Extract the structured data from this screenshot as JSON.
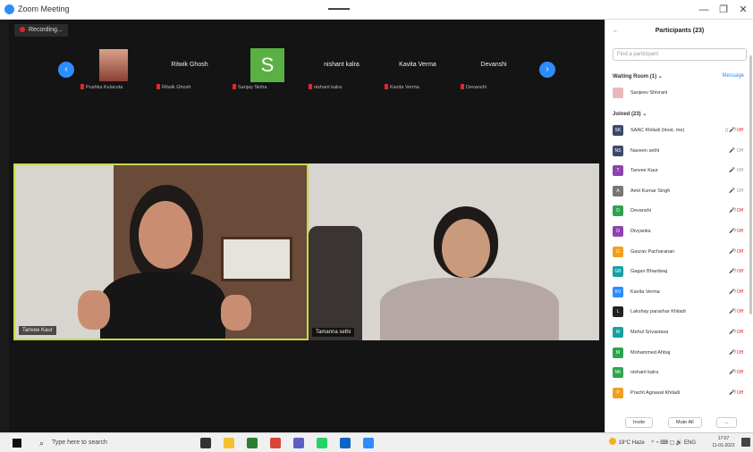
{
  "window": {
    "title": "Zoom Meeting",
    "controls": {
      "minimize": "—",
      "restore": "❐",
      "close": "✕"
    }
  },
  "meeting": {
    "recording_label": "Recording...",
    "gallery": [
      {
        "name": "",
        "label": "Pushka Kulacuta",
        "kind": "photo"
      },
      {
        "name": "Ritwik Ghosh",
        "label": "Ritwik Ghosh",
        "kind": "name"
      },
      {
        "name": "S",
        "label": "Sanjay Sinha",
        "kind": "letter"
      },
      {
        "name": "nishant kalra",
        "label": "nishant kalra",
        "kind": "name"
      },
      {
        "name": "Kavita Verma",
        "label": "Kavita Verma",
        "kind": "name"
      },
      {
        "name": "Devanshi",
        "label": "Devanshi",
        "kind": "name"
      }
    ],
    "main_videos": [
      {
        "label": "Tanvee Kaur"
      },
      {
        "label": "Tamanna sethi"
      }
    ]
  },
  "participants": {
    "title": "Participants (23)",
    "search_placeholder": "Find a participant",
    "waiting_room_label": "Waiting Room (1)",
    "message_button": "Message",
    "waiting": [
      {
        "name": "Sanjeev Shivrani",
        "color": "#e9b9b9",
        "initial": ""
      }
    ],
    "joined_label": "Joined (23)",
    "joined": [
      {
        "name": "SAAC Khiladi (Host, me)",
        "initial": "SK",
        "color": "#3b4a6b",
        "status": "▯ 🎤̸ Off",
        "status_color": "#e02828"
      },
      {
        "name": "Naveen sethi",
        "initial": "NS",
        "color": "#3b4a6b",
        "status": "🎤 Off",
        "status_color": "#999999"
      },
      {
        "name": "Tanvee Kaur",
        "initial": "T",
        "color": "#8e44ad",
        "status": "🎤 Off",
        "status_color": "#999999"
      },
      {
        "name": "Amit Kumar Singh",
        "initial": "A",
        "color": "#777777",
        "status": "🎤 Off",
        "status_color": "#999999"
      },
      {
        "name": "Devanshi",
        "initial": "D",
        "color": "#2ea44f",
        "status": "🎤̸ Off",
        "status_color": "#e02828"
      },
      {
        "name": "Divyanka",
        "initial": "D",
        "color": "#8e44ad",
        "status": "🎤̸ Off",
        "status_color": "#e02828"
      },
      {
        "name": "Gaurav Pacharanan",
        "initial": "G",
        "color": "#f0a020",
        "status": "🎤̸ Off",
        "status_color": "#e02828"
      },
      {
        "name": "Gagan Bhardwaj",
        "initial": "GB",
        "color": "#16a0a0",
        "status": "🎤̸ Off",
        "status_color": "#e02828"
      },
      {
        "name": "Kavita Verma",
        "initial": "KV",
        "color": "#2d8cff",
        "status": "🎤̸ Off",
        "status_color": "#e02828"
      },
      {
        "name": "Lakshay parashar Khiladi",
        "initial": "L",
        "color": "#222222",
        "status": "🎤̸ Off",
        "status_color": "#e02828"
      },
      {
        "name": "Mehul Srivastava",
        "initial": "M",
        "color": "#16a0a0",
        "status": "🎤̸ Off",
        "status_color": "#e02828"
      },
      {
        "name": "Mohammed Ahbaj",
        "initial": "M",
        "color": "#2ea44f",
        "status": "🎤̸ Off",
        "status_color": "#e02828"
      },
      {
        "name": "nishant kalra",
        "initial": "NK",
        "color": "#2ea44f",
        "status": "🎤̸ Off",
        "status_color": "#e02828"
      },
      {
        "name": "Pracht Agrawal Khiladi",
        "initial": "P",
        "color": "#f0a020",
        "status": "🎤̸ Off",
        "status_color": "#e02828"
      }
    ],
    "footer": {
      "invite": "Invite",
      "mute_all": "Mute All",
      "more": "..."
    }
  },
  "taskbar": {
    "search_placeholder": "Type here to search",
    "apps": [
      {
        "icon": "task-view-icon",
        "color": "#333333"
      },
      {
        "icon": "file-explorer-icon",
        "color": "#f3c22c"
      },
      {
        "icon": "notes-app-icon",
        "color": "#2e7d32"
      },
      {
        "icon": "chrome-icon",
        "color": "#db4437"
      },
      {
        "icon": "teams-icon",
        "color": "#5b5fc7"
      },
      {
        "icon": "whatsapp-icon",
        "color": "#25d366"
      },
      {
        "icon": "outlook-icon",
        "color": "#0a66c2"
      },
      {
        "icon": "zoom-icon",
        "color": "#2d8cff"
      }
    ],
    "weather": "19°C Haze",
    "tray_icons": "^ ◔ ⌨ ▢ 🔊 ENG",
    "time": "17:07",
    "date": "11-01-2022"
  }
}
